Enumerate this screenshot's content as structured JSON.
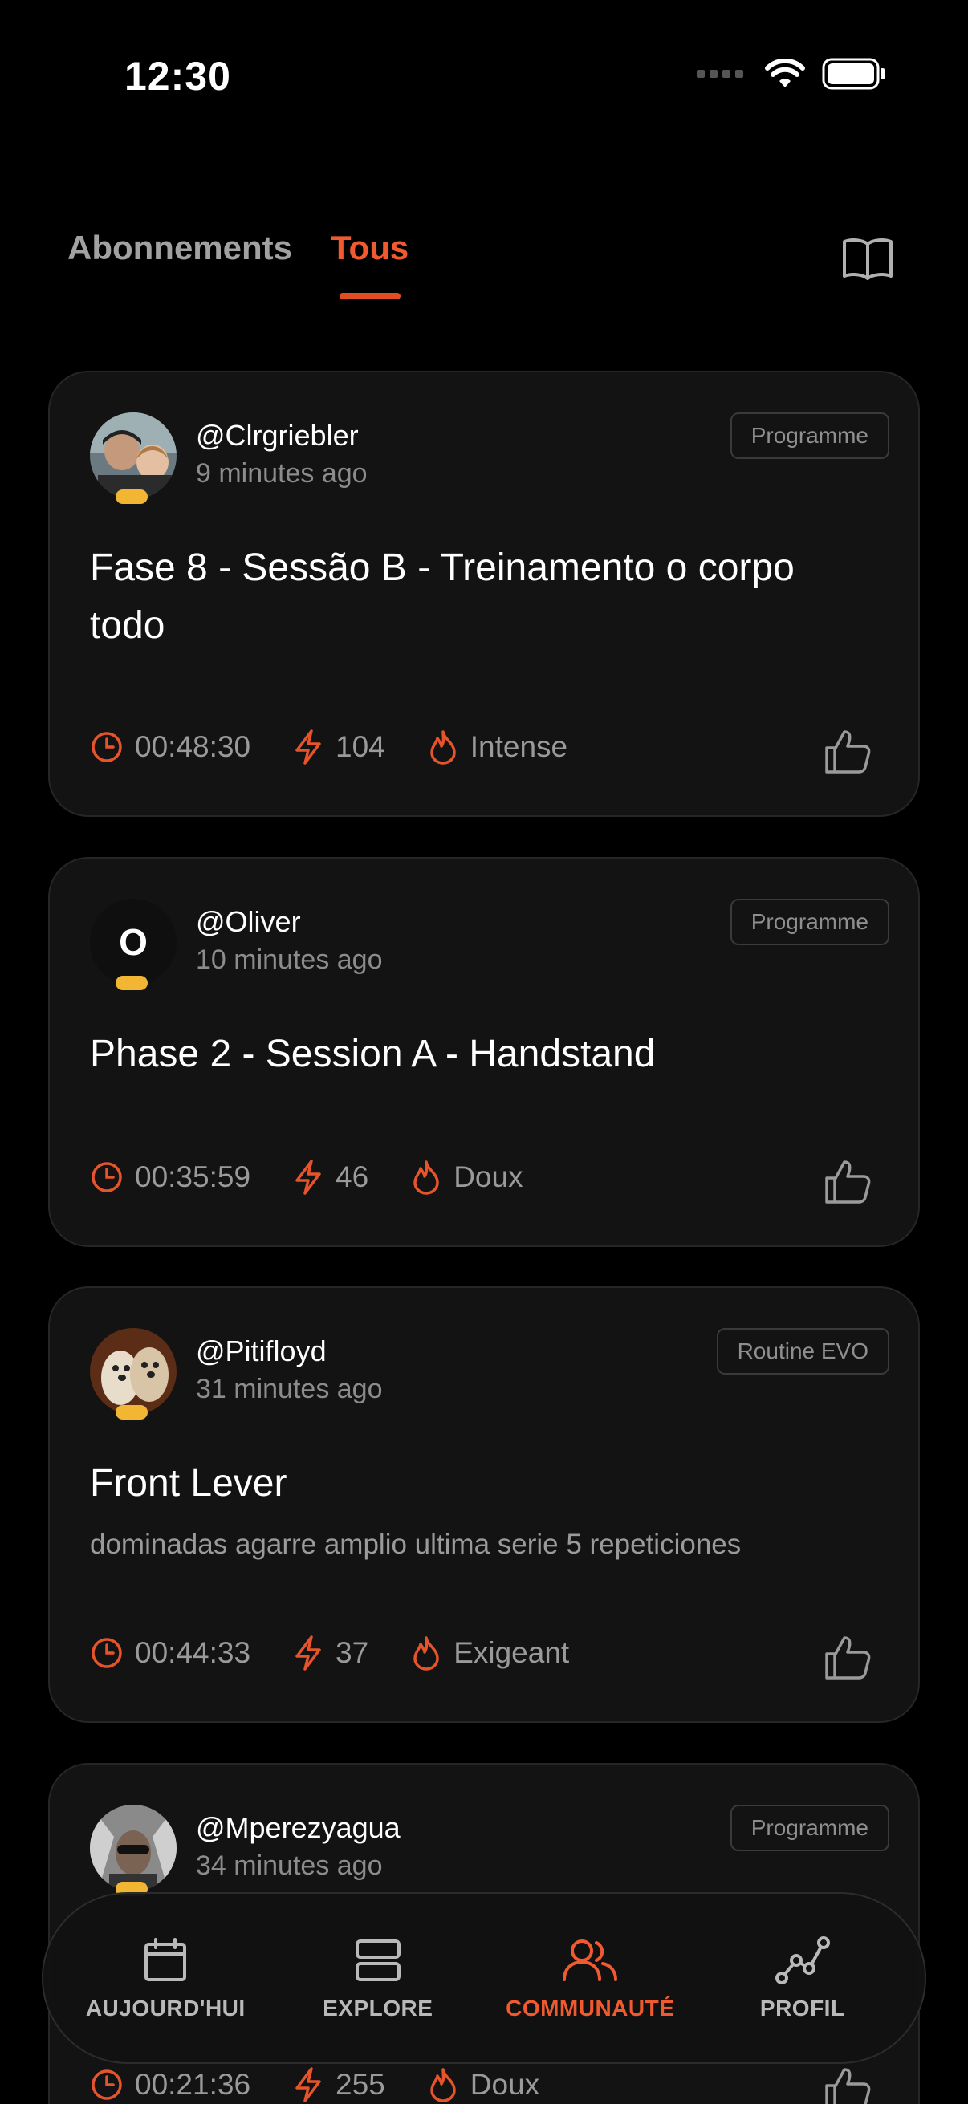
{
  "status_bar": {
    "time": "12:30"
  },
  "tabs": [
    {
      "label": "Abonnements",
      "active": false
    },
    {
      "label": "Tous",
      "active": true
    }
  ],
  "colors": {
    "accent": "#f05a2e",
    "background": "#000000",
    "card": "#131313",
    "badge": "#f2b632"
  },
  "feed": [
    {
      "username": "@Clrgriebler",
      "time_ago": "9 minutes ago",
      "tag": "Programme",
      "title": "Fase 8 - Sessão B - Treinamento o corpo todo",
      "description": "",
      "duration": "00:48:30",
      "energy": "104",
      "intensity": "Intense"
    },
    {
      "username": "@Oliver",
      "avatar_letter": "O",
      "time_ago": "10 minutes ago",
      "tag": "Programme",
      "title": "Phase 2 - Session A - Handstand",
      "description": "",
      "duration": "00:35:59",
      "energy": "46",
      "intensity": "Doux"
    },
    {
      "username": "@Pitifloyd",
      "time_ago": "31 minutes ago",
      "tag": "Routine EVO",
      "title": "Front Lever",
      "description": "dominadas agarre amplio ultima serie 5 repeticiones",
      "duration": "00:44:33",
      "energy": "37",
      "intensity": "Exigeant"
    },
    {
      "username": "@Mperezyagua",
      "time_ago": "34 minutes ago",
      "tag": "Programme",
      "title": "",
      "description": "",
      "duration": "00:21:36",
      "energy": "255",
      "intensity": "Doux"
    }
  ],
  "nav": [
    {
      "label": "AUJOURD'HUI",
      "icon": "calendar-icon",
      "active": false
    },
    {
      "label": "EXPLORE",
      "icon": "stack-icon",
      "active": false
    },
    {
      "label": "COMMUNAUTÉ",
      "icon": "community-icon",
      "active": true
    },
    {
      "label": "PROFIL",
      "icon": "chart-icon",
      "active": false
    }
  ]
}
